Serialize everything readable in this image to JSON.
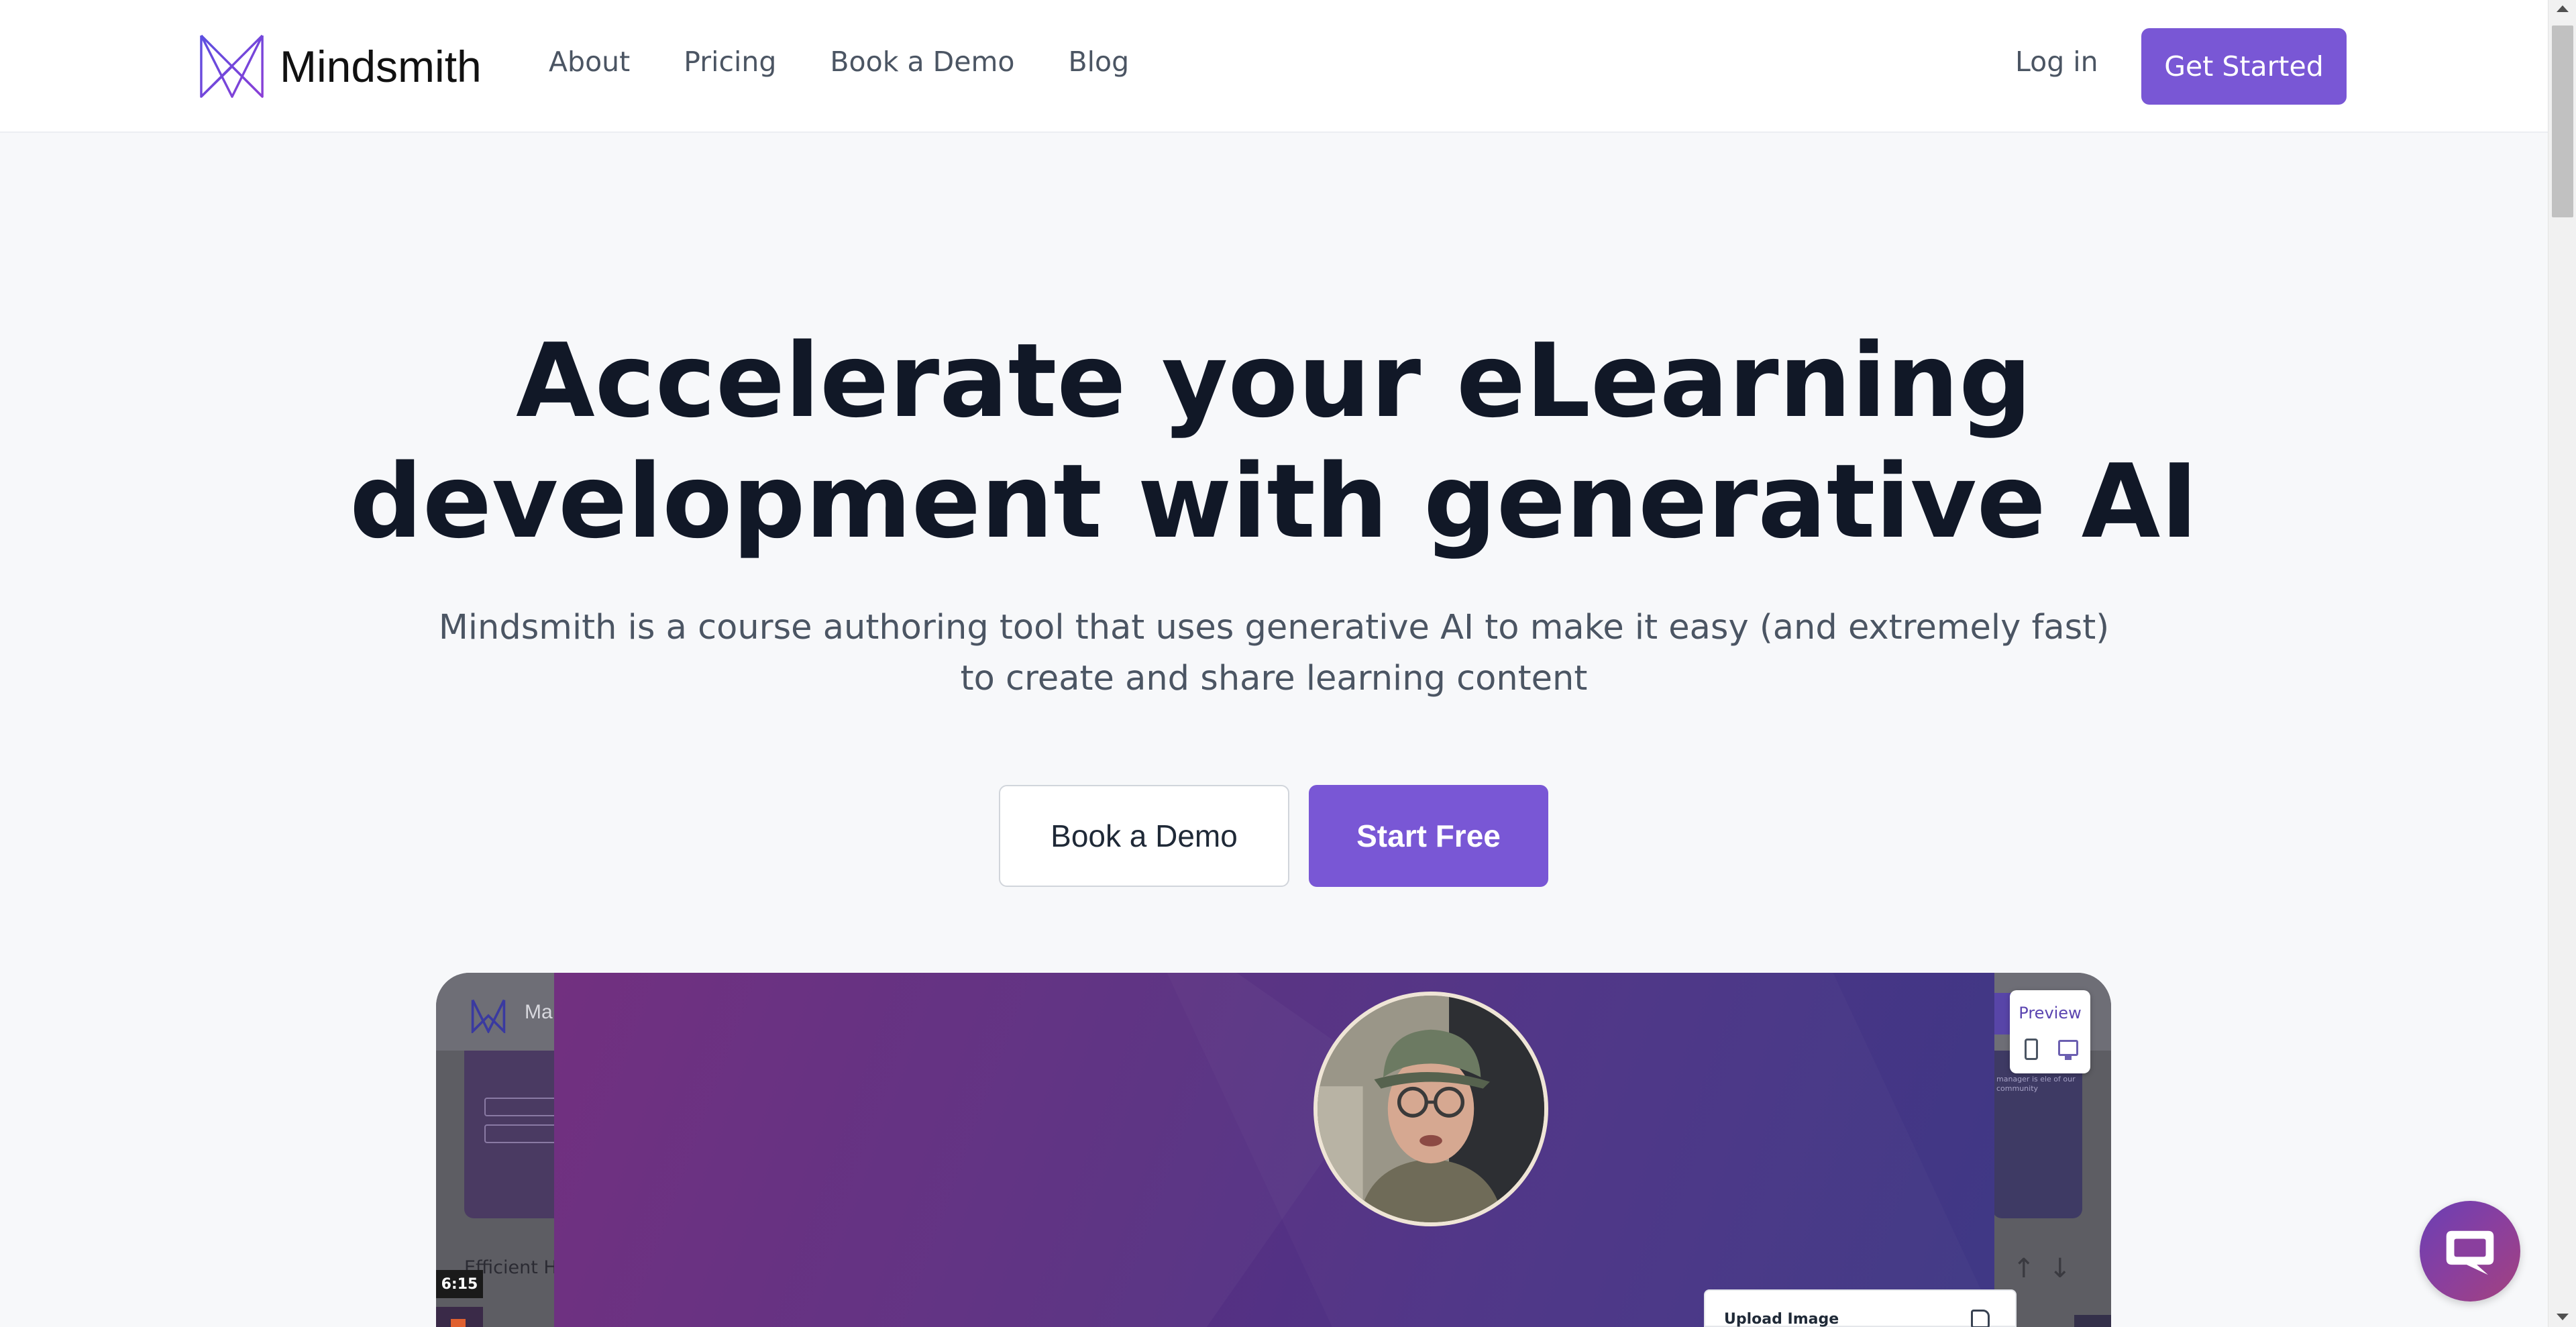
{
  "nav": {
    "brand": "Mindsmith",
    "links": [
      "About",
      "Pricing",
      "Book a Demo",
      "Blog"
    ],
    "login": "Log in",
    "cta": "Get Started"
  },
  "hero": {
    "title_line1": "Accelerate your eLearning",
    "title_line2": "development with generative AI",
    "subtitle": "Mindsmith is a course authoring tool that uses generative AI to make it easy (and extremely fast) to create and share learning content",
    "demo_button": "Book a Demo",
    "start_button": "Start Free"
  },
  "video": {
    "app_brand": "Ma",
    "left_card_title": "Efficient H",
    "duration": "6:15",
    "preview_label": "Preview",
    "upload_label": "Upload Image",
    "right_panel_text": "manager is ele of our community"
  },
  "colors": {
    "accent": "#7957d5",
    "text_primary": "#111827",
    "text_secondary": "#4b5563",
    "page_bg": "#f7f8fa",
    "video_gradient_start": "#6e2a7c",
    "video_gradient_end": "#3f3885"
  },
  "icons": {
    "logo": "mindsmith-m-logo",
    "chat": "chat-bubble-icon",
    "preview_mobile": "phone-icon",
    "preview_desktop": "desktop-icon",
    "upload": "file-icon",
    "move_up": "arrow-up-icon",
    "move_down": "arrow-down-icon"
  }
}
